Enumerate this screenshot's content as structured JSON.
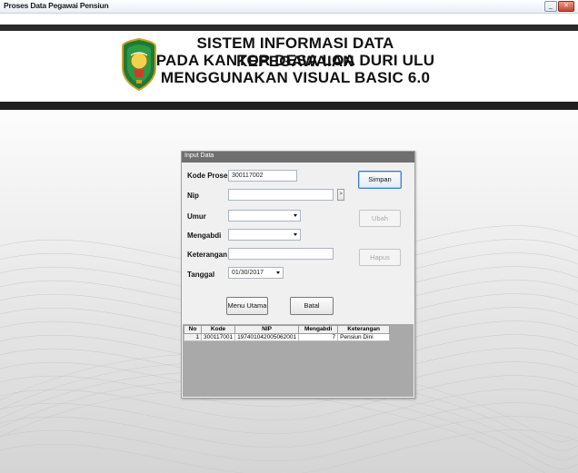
{
  "window": {
    "title": "Proses Data Pegawai Pensiun",
    "buttons": {
      "minimize": "_",
      "maximize": "□",
      "close": "✕"
    }
  },
  "header": {
    "line1": "SISTEM INFORMASI DATA KEPEGAWAIAN",
    "line2": "PADA KANTOR DESA LOA DURI ULU",
    "line3": "MENGGUNAKAN VISUAL BASIC 6.0"
  },
  "panel": {
    "title": "Input Data",
    "fields": {
      "kode_proses": {
        "label": "Kode Proses",
        "value": "300117002"
      },
      "nip": {
        "label": "Nip",
        "value": "",
        "browse_label": ">"
      },
      "umur": {
        "label": "Umur",
        "value": ""
      },
      "mengabdi": {
        "label": "Mengabdi",
        "value": ""
      },
      "keterangan": {
        "label": "Keterangan",
        "value": ""
      },
      "tanggal": {
        "label": "Tanggal",
        "value": "01/30/2017"
      }
    },
    "buttons": {
      "simpan": "Simpan",
      "ubah": "Ubah",
      "hapus": "Hapus",
      "menu_utama": "Menu Utama",
      "batal": "Batal"
    }
  },
  "grid": {
    "columns": [
      "No",
      "Kode",
      "NIP",
      "Mengabdi",
      "Keterangan"
    ],
    "rows": [
      {
        "no": "1",
        "kode": "300117001",
        "nip": "197401042005062001",
        "mengabdi": "7",
        "keterangan": "Pensiun Dini"
      }
    ]
  },
  "colors": {
    "header_strip": "#1f1f1f",
    "panel_title_bar": "#6f6f6f",
    "primary_button_border": "#3d7bc8"
  }
}
